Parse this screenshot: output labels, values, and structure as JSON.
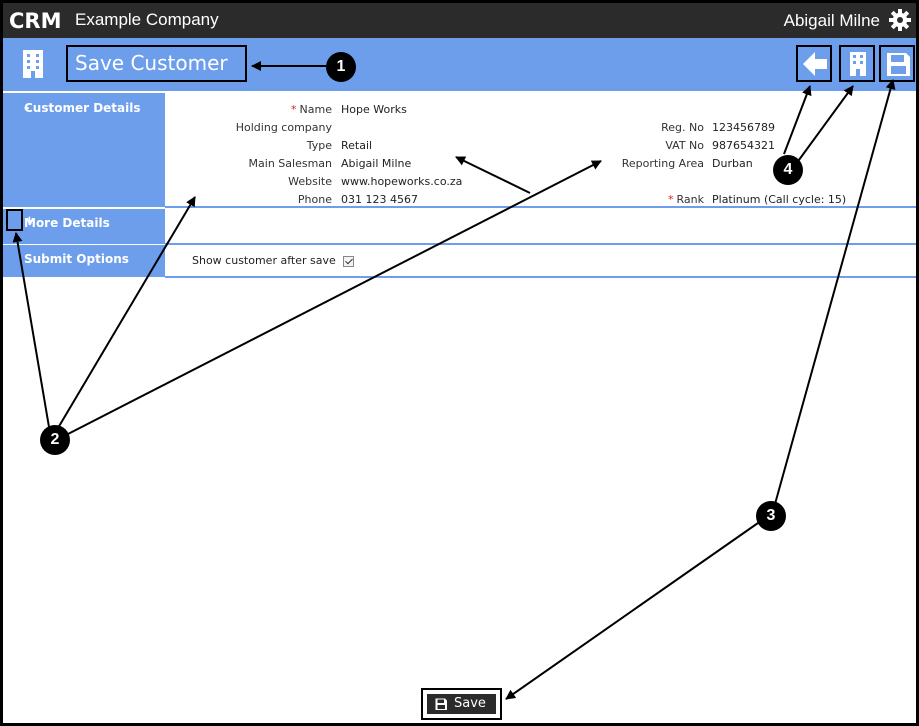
{
  "app": {
    "logo_text": "CRM",
    "company": "Example Company",
    "user": "Abigail Milne"
  },
  "header": {
    "title": "Save Customer",
    "buttons": [
      {
        "name": "back",
        "icon": "arrow-left-icon"
      },
      {
        "name": "customer",
        "icon": "building-icon"
      },
      {
        "name": "save",
        "icon": "floppy-disk-icon"
      }
    ]
  },
  "sections": {
    "customer_details": {
      "toggle": "-",
      "label": "Customer Details"
    },
    "more_details": {
      "toggle": "+",
      "label": "More Details"
    },
    "submit_options": {
      "label": "Submit Options"
    }
  },
  "fields_left": [
    {
      "label": "Name",
      "value": "Hope Works",
      "required": "*"
    },
    {
      "label": "Holding company",
      "value": ""
    },
    {
      "label": "Type",
      "value": "Retail"
    },
    {
      "label": "Main Salesman",
      "value": "Abigail Milne"
    },
    {
      "label": "Website",
      "value": "www.hopeworks.co.za"
    },
    {
      "label": "Phone",
      "value": "031 123 4567"
    }
  ],
  "fields_right": [
    {
      "label": "Reg. No",
      "value": "123456789"
    },
    {
      "label": "VAT No",
      "value": "987654321"
    },
    {
      "label": "Reporting Area",
      "value": "Durban"
    },
    {
      "label": "Rank",
      "value": "Platinum (Call cycle: 15)",
      "required": "*"
    }
  ],
  "submit": {
    "show_after_save_label": "Show customer after save",
    "show_after_save_checked": true
  },
  "callouts": [
    "1",
    "2",
    "3",
    "4"
  ],
  "footer": {
    "save_label": "Save"
  },
  "colors": {
    "header_blue": "#6d9eeb",
    "topbar": "#2b2b2b",
    "required": "#e02020"
  }
}
